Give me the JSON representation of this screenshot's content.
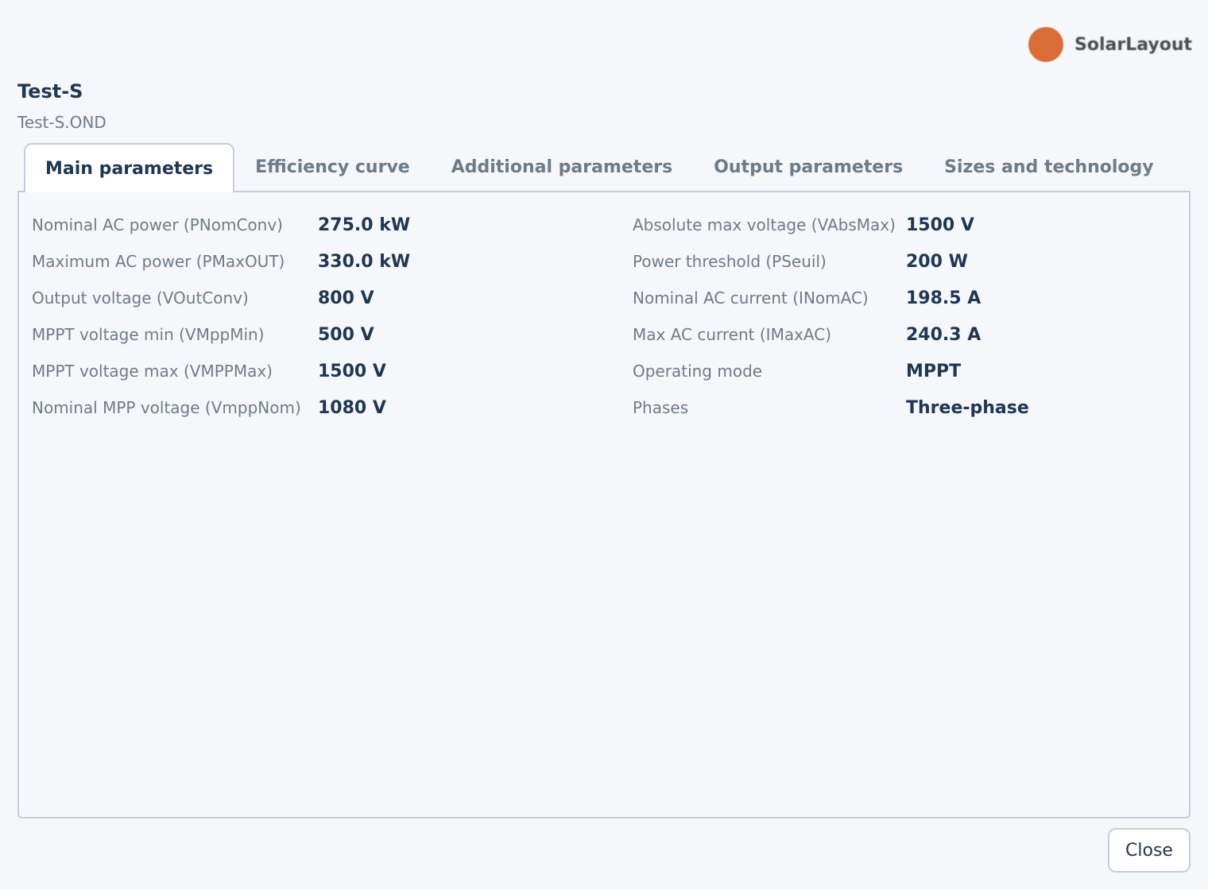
{
  "brand": {
    "name": "SolarLayout",
    "color": "#d96d35"
  },
  "header": {
    "title": "Test-S",
    "subtitle": "Test-S.OND"
  },
  "tabs": [
    {
      "label": "Main parameters",
      "active": true
    },
    {
      "label": "Efficiency curve",
      "active": false
    },
    {
      "label": "Additional parameters",
      "active": false
    },
    {
      "label": "Output parameters",
      "active": false
    },
    {
      "label": "Sizes and technology",
      "active": false
    }
  ],
  "params_left": [
    {
      "label": "Nominal AC power (PNomConv)",
      "value": "275.0 kW"
    },
    {
      "label": "Maximum AC power (PMaxOUT)",
      "value": "330.0 kW"
    },
    {
      "label": "Output voltage (VOutConv)",
      "value": "800 V"
    },
    {
      "label": "MPPT voltage min (VMppMin)",
      "value": "500 V"
    },
    {
      "label": "MPPT voltage max (VMPPMax)",
      "value": "1500 V"
    },
    {
      "label": "Nominal MPP voltage (VmppNom)",
      "value": "1080 V"
    }
  ],
  "params_right": [
    {
      "label": "Absolute max voltage (VAbsMax)",
      "value": "1500 V"
    },
    {
      "label": "Power threshold (PSeuil)",
      "value": "200 W"
    },
    {
      "label": "Nominal AC current (INomAC)",
      "value": "198.5 A"
    },
    {
      "label": "Max AC current (IMaxAC)",
      "value": "240.3 A"
    },
    {
      "label": "Operating mode",
      "value": "MPPT"
    },
    {
      "label": "Phases",
      "value": "Three-phase"
    }
  ],
  "footer": {
    "close_label": "Close"
  }
}
